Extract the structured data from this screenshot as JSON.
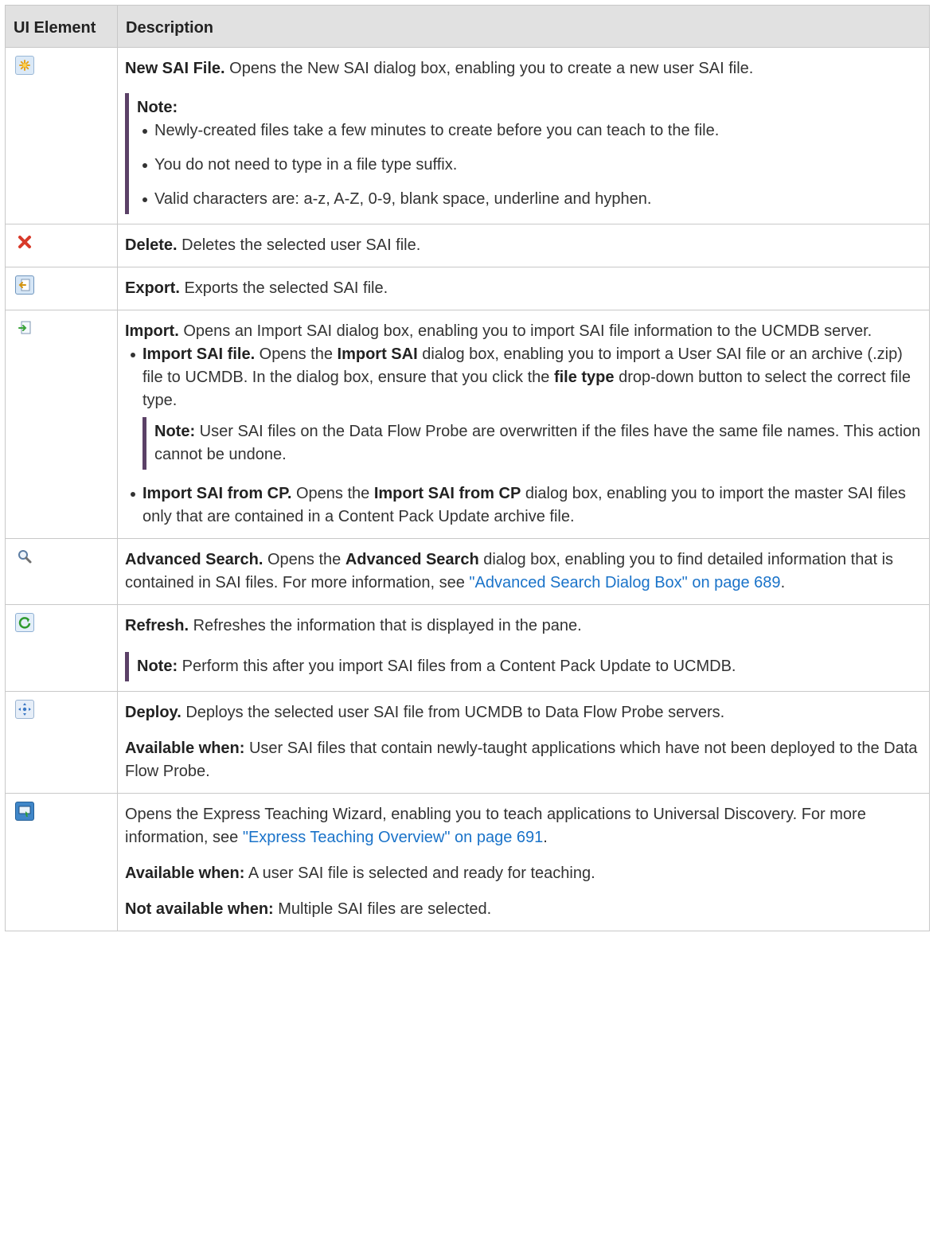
{
  "header": {
    "col1": "UI Element",
    "col2": "Description"
  },
  "rows": {
    "new": {
      "icon": "new-file-icon",
      "title": "New SAI File.",
      "text": " Opens the New SAI dialog box, enabling you to create a new user SAI file.",
      "note_label": "Note:",
      "bullets": [
        "Newly-created files take a few minutes to create before you can teach to the file.",
        "You do not need to type in a file type suffix.",
        "Valid characters are: a-z, A-Z, 0-9, blank space, underline and hyphen."
      ]
    },
    "delete": {
      "icon": "delete-icon",
      "title": "Delete.",
      "text": " Deletes the selected user SAI file."
    },
    "export": {
      "icon": "export-icon",
      "title": "Export.",
      "text": " Exports the selected SAI file."
    },
    "import": {
      "icon": "import-icon",
      "title": "Import.",
      "text": " Opens an Import SAI dialog box, enabling you to import SAI file information to the UCMDB server.",
      "sub1": {
        "title": "Import SAI file.",
        "t1": " Opens the ",
        "b1": "Import SAI",
        "t2": " dialog box, enabling you to import a User SAI file or an archive (.zip) file to UCMDB. In the dialog box, ensure that you click the ",
        "b2": "file type",
        "t3": " drop-down button to select the correct file type.",
        "note_label": "Note:",
        "note_text": "  User SAI files on the Data Flow Probe are overwritten if the files have the same file names. This action cannot be undone."
      },
      "sub2": {
        "title": "Import SAI from CP.",
        "t1": " Opens the ",
        "b1": "Import SAI from CP",
        "t2": " dialog box, enabling you to import the master SAI files only that are contained in a Content Pack Update archive file."
      }
    },
    "search": {
      "icon": "magnifier-icon",
      "title": "Advanced Search.",
      "t1": " Opens the ",
      "b1": "Advanced Search",
      "t2": " dialog box, enabling you to find detailed information that is contained in SAI files. For more information, see ",
      "link": "\"Advanced Search Dialog Box\" on page 689",
      "t3": "."
    },
    "refresh": {
      "icon": "refresh-icon",
      "title": "Refresh.",
      "text": " Refreshes the information that is displayed in the pane.",
      "note_label": "Note:",
      "note_text": "  Perform this after you import SAI files from a Content Pack Update to UCMDB."
    },
    "deploy": {
      "icon": "deploy-icon",
      "title": "Deploy.",
      "text": " Deploys the selected user SAI file from UCMDB to Data Flow Probe servers.",
      "avail_label": "Available when:",
      "avail_text": " User SAI files that contain newly-taught applications which have not been deployed to the Data Flow Probe."
    },
    "teach": {
      "icon": "teaching-wizard-icon",
      "text": "Opens the Express Teaching Wizard, enabling you to teach applications to Universal Discovery. For more information, see ",
      "link": "\"Express Teaching Overview\" on page 691",
      "t2": ".",
      "avail_label": "Available when:",
      "avail_text": " A user SAI file is selected and ready for teaching.",
      "notavail_label": "Not available when:",
      "notavail_text": "  Multiple SAI files are selected."
    }
  }
}
